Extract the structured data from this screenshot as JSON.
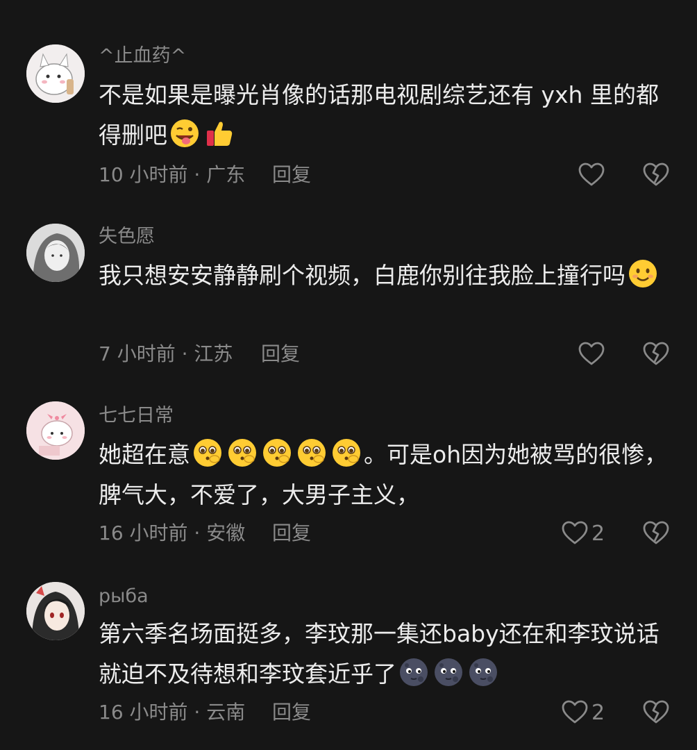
{
  "comments": [
    {
      "username": "^止血药^",
      "text_before": "不是如果是曝光肖像的话那电视剧综艺还有 yxh 里的都得删吧",
      "emojis": [
        "wink-tongue-emoji",
        "thumbs-up-emoji"
      ],
      "text_after": "",
      "time": "10 小时前 · 广东",
      "reply": "回复",
      "likes": ""
    },
    {
      "username": "失色愿",
      "text_before": "我只想安安静静刷个视频，白鹿你别往我脸上撞行吗",
      "emojis": [
        "smile-emoji"
      ],
      "text_after": "",
      "time": "7 小时前 · 江苏",
      "reply": "回复",
      "likes": ""
    },
    {
      "username": "七七日常",
      "text_before": "她超在意",
      "emojis": [
        "pleading-emoji",
        "pleading-emoji",
        "pleading-emoji",
        "pleading-emoji",
        "pleading-emoji"
      ],
      "text_after": "。可是oh因为她被骂的很惨，脾气大，不爱了，大男子主义，",
      "time": "16 小时前 · 安徽",
      "reply": "回复",
      "likes": "2"
    },
    {
      "username": "рыба",
      "text_before": "第六季名场面挺多，李玟那一集还baby还在和李玟说话就迫不及待想和李玟套近乎了",
      "emojis": [
        "moon-face-emoji",
        "moon-face-emoji",
        "moon-face-emoji"
      ],
      "text_after": "",
      "time": "16 小时前 · 云南",
      "reply": "回复",
      "likes": "2"
    }
  ],
  "colors": {
    "background": "#161616",
    "text": "#ececec",
    "muted": "#8a8a8a"
  }
}
